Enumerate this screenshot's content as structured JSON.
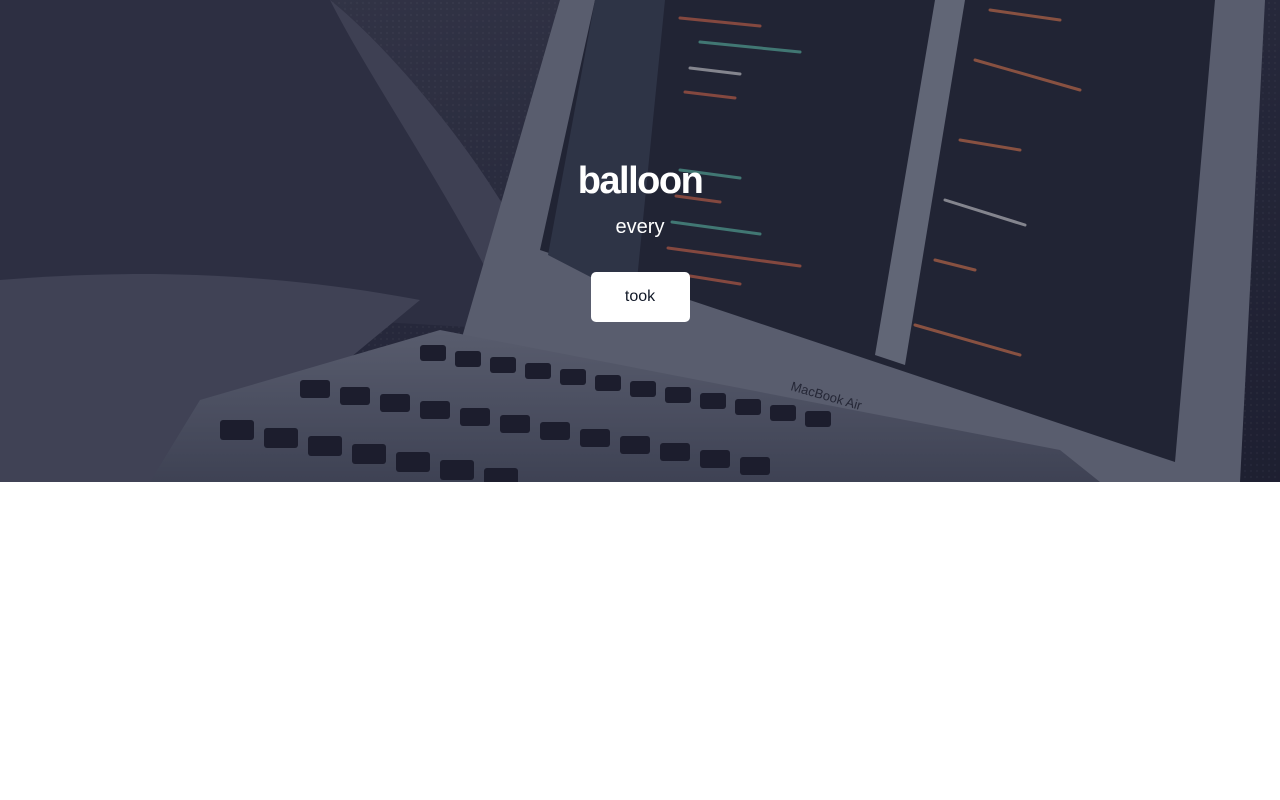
{
  "hero": {
    "title": "balloon",
    "subtitle": "every",
    "button_label": "took",
    "laptop_label": "MacBook Air",
    "colors": {
      "overlay": "#1c1e34",
      "button_bg": "#ffffff",
      "button_text": "#111827",
      "heading_text": "#ffffff"
    }
  }
}
